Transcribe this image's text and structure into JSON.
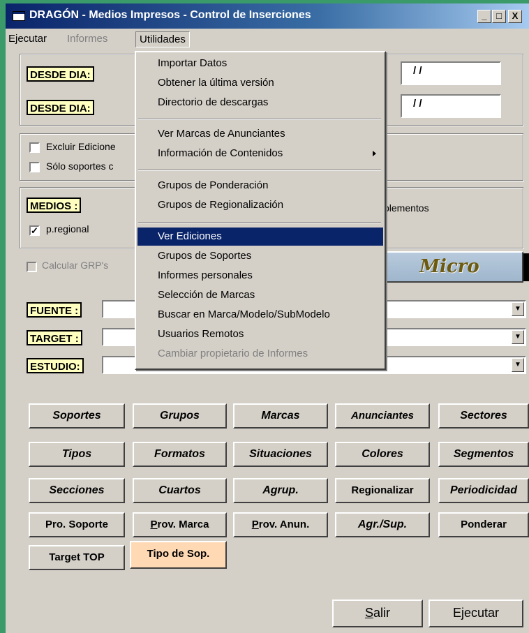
{
  "window": {
    "title": "DRAGÓN - Medios Impresos - Control de Inserciones",
    "minimize": "_",
    "maximize": "□",
    "close": "X"
  },
  "menubar": {
    "ejecutar": "Ejecutar",
    "informes": "Informes",
    "utilidades": "Utilidades"
  },
  "dates": {
    "desde1_label": "DESDE DIA:",
    "desde2_label": "DESDE DIA:",
    "date1_value": "/ /",
    "date2_value": "/ /"
  },
  "options": {
    "excluir_label": "Excluir Edicione",
    "solo_label": "Sólo soportes c",
    "excluir_checked": false,
    "solo_checked": false
  },
  "medios": {
    "label": "MEDIOS :",
    "pregional_label": "p.regional",
    "pregional_checked": true,
    "suplementos_label": "plementos"
  },
  "grp": {
    "label": "Calcular GRP's",
    "checked": false
  },
  "micro_label": "Micro",
  "fields": {
    "fuente_label": "FUENTE :",
    "target_label": "TARGET :",
    "estudio_label": "ESTUDIO:",
    "fuente_value": "",
    "target_value": "",
    "estudio_value": ""
  },
  "buttons": {
    "soportes": "Soportes",
    "grupos": "Grupos",
    "marcas": "Marcas",
    "anunciantes": "Anunciantes",
    "sectores": "Sectores",
    "tipos": "Tipos",
    "formatos": "Formatos",
    "situaciones": "Situaciones",
    "colores": "Colores",
    "segmentos": "Segmentos",
    "secciones": "Secciones",
    "cuartos": "Cuartos",
    "agrup": "Agrup.",
    "regionalizar": "Regionalizar",
    "periodicidad": "Periodicidad",
    "pro_soporte": "Pro. Soporte",
    "prov_marca_u": "P",
    "prov_marca_rest": "rov. Marca",
    "prov_anun_u": "P",
    "prov_anun_rest": "rov. Anun.",
    "agr_sup": "Agr./Sup.",
    "ponderar": "Ponderar",
    "target_top": "Target TOP",
    "tipo_sop": "Tipo de Sop.",
    "salir_u": "S",
    "salir_rest": "alir",
    "ejecutar": "Ejecutar"
  },
  "dropdown": {
    "items": [
      "Importar Datos",
      "Obtener la última versión",
      "Directorio de descargas",
      "Ver Marcas de Anunciantes",
      "Información de Contenidos",
      "Grupos de Ponderación",
      "Grupos de Regionalización",
      "Ver Ediciones",
      "Grupos de Soportes",
      "Informes personales",
      "Selección de Marcas",
      "Buscar en Marca/Modelo/SubModelo",
      "Usuarios Remotos",
      "Cambiar propietario de Informes"
    ],
    "selected": "Ver Ediciones",
    "disabled": "Cambiar propietario de Informes",
    "submenu_item": "Información de Contenidos"
  },
  "colors": {
    "desktop": "#3a9a6a",
    "title_start": "#0a246a",
    "title_end": "#a6caf0",
    "face": "#d4d0c8",
    "label_bg": "#ffffc0",
    "highlight": "#0a246a",
    "peach": "#ffd9b4"
  }
}
